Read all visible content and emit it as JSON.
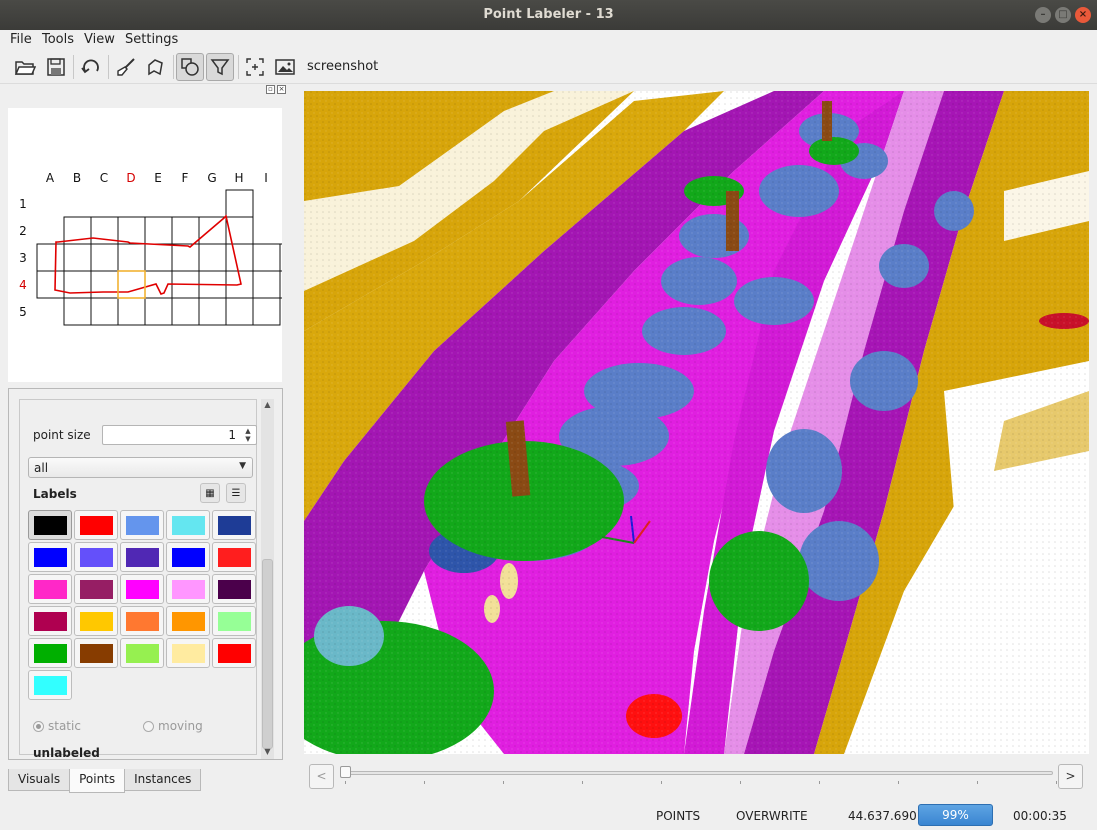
{
  "window": {
    "title": "Point Labeler - 13"
  },
  "menu": [
    "File",
    "Tools",
    "View",
    "Settings"
  ],
  "toolbar": {
    "buttons": [
      "open-icon",
      "save-icon",
      "reload-icon",
      "brush-icon",
      "polygon-icon",
      "cylinder-icon",
      "filter-icon",
      "center-icon",
      "image-icon"
    ],
    "screenshot_label": "screenshot"
  },
  "minimap": {
    "columns": [
      "A",
      "B",
      "C",
      "D",
      "E",
      "F",
      "G",
      "H",
      "I"
    ],
    "rows": [
      "1",
      "2",
      "3",
      "4",
      "5"
    ],
    "active_column": "D",
    "active_row": "4",
    "highlight_color": "#d40000",
    "track_color": "#e00000",
    "cursor_color": "#f2b233"
  },
  "panel": {
    "point_size_label": "point size",
    "point_size_value": "1",
    "filter_value": "all",
    "labels_title": "Labels",
    "label_colors": [
      "#000000",
      "#ff0000",
      "#6495ed",
      "#64e6f0",
      "#1e3c96",
      "#0000ff",
      "#6450fa",
      "#5028b4",
      "#0000ff",
      "#ff1e1e",
      "#ff28c8",
      "#961e64",
      "#ff00ff",
      "#ff96ff",
      "#4b004b",
      "#af0050",
      "#ffc800",
      "#ff7830",
      "#ff9600",
      "#96ff96",
      "#00af00",
      "#873c00",
      "#96f050",
      "#ffeba0",
      "#ff0000",
      "#32ffff"
    ],
    "radio_static": "static",
    "radio_moving": "moving",
    "selected_label_name": "unlabeled"
  },
  "tabs": [
    "Visuals",
    "Points",
    "Instances"
  ],
  "active_tab": "Points",
  "timeline": {
    "prev": "<",
    "next": ">",
    "position": 0
  },
  "status": {
    "mode": "POINTS",
    "write_mode": "OVERWRITE",
    "point_count": "44.637.690",
    "progress": "99%",
    "progress_value": 0.99,
    "time": "00:00:35"
  }
}
